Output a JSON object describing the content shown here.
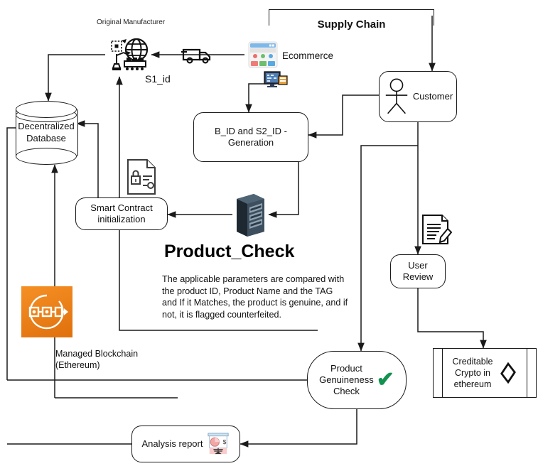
{
  "diagram": {
    "title_block": {
      "supply_chain": "Supply Chain"
    },
    "nodes": {
      "original_manufacturer": "Original Manufacturer",
      "s1_id": "S1_id",
      "ecommerce": "Ecommerce",
      "customer": "Customer",
      "decentralized_database": "Decentralized\nDatabase",
      "decentralized_database_line1": "Decentralized",
      "decentralized_database_line2": "Database",
      "bid_generation_line1": "B_ID and S2_ID -",
      "bid_generation_line2": "Generation",
      "smart_contract_line1": "Smart Contract",
      "smart_contract_line2": "initialization",
      "user_review_line1": "User",
      "user_review_line2": "Review",
      "product_genuineness_line1": "Product",
      "product_genuineness_line2": "Genuineness",
      "product_genuineness_line3": "Check",
      "creditable_crypto_line1": "Creditable",
      "creditable_crypto_line2": "Crypto in",
      "creditable_crypto_line3": "ethereum",
      "analysis_report": "Analysis report",
      "managed_blockchain_line1": "Managed Blockchain",
      "managed_blockchain_line2": "(Ethereum)"
    },
    "product_check": {
      "heading": "Product_Check",
      "body_line1": "The applicable parameters are compared with",
      "body_line2": "the product ID, Product Name and the TAG",
      "body_line3": "and If it Matches, the product is genuine, and if",
      "body_line4": "not, it is flagged counterfeited."
    },
    "icons": {
      "factory_globe": "factory-globe-icon",
      "truck": "truck-icon",
      "storefront": "storefront-icon",
      "monitor": "monitor-icon",
      "contract_lock": "contract-lock-icon",
      "server_rack": "server-rack-icon",
      "review_document": "review-document-icon",
      "aws_managed_blockchain": "aws-managed-blockchain-icon",
      "presentation_chart": "presentation-chart-icon",
      "ethereum": "ethereum-icon",
      "green_check": "green-check-icon",
      "person": "person-icon"
    },
    "colors": {
      "stroke": "#1a1a1a",
      "check_green": "#12924f",
      "aws_orange": "#e8820c",
      "chart_pink": "#f2a7a7",
      "store_blue": "#7eb8e8"
    },
    "check_glyph": "✔"
  }
}
